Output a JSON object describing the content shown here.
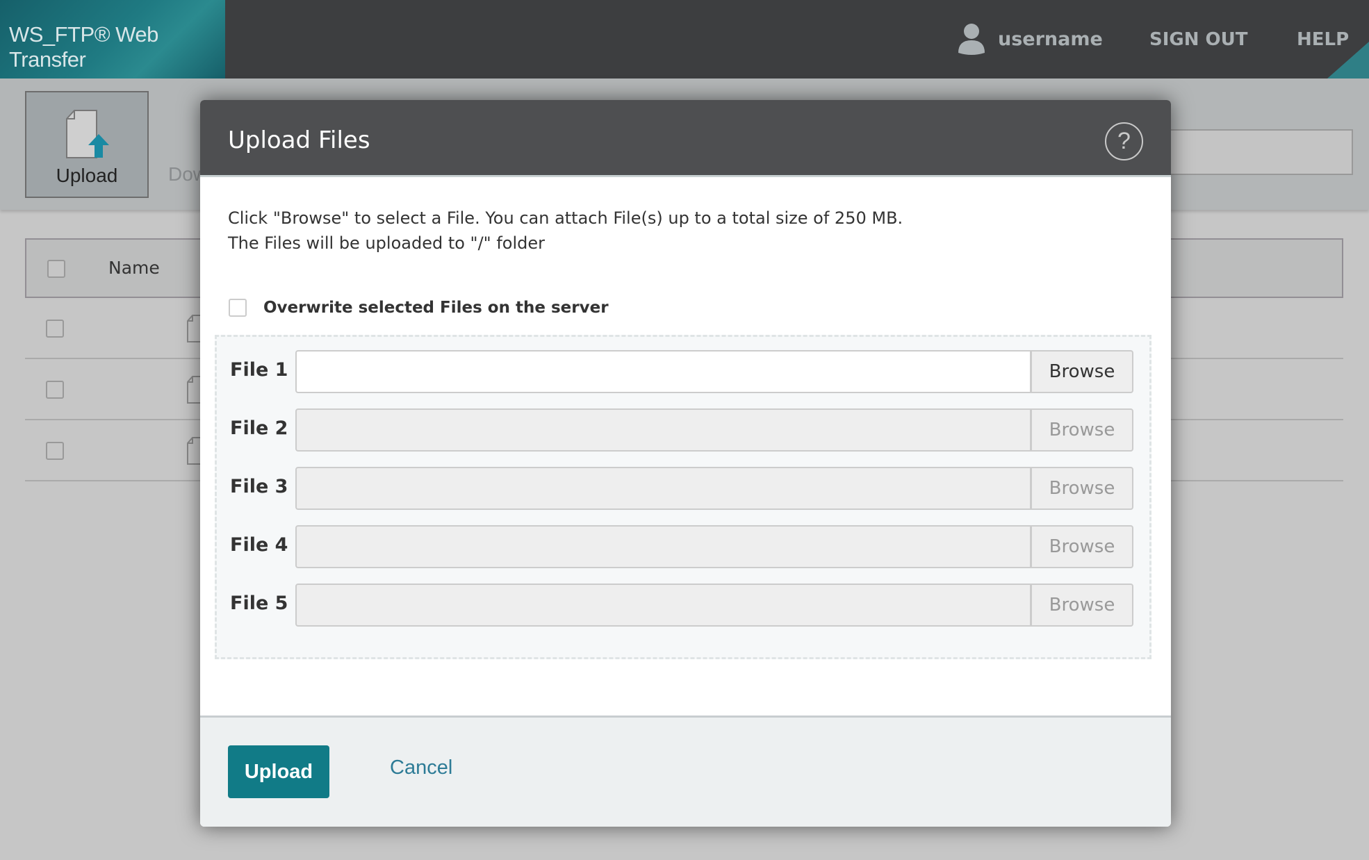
{
  "app": {
    "title": "WS_FTP® Web Transfer"
  },
  "header": {
    "username": "username",
    "sign_out": "SIGN OUT",
    "help": "HELP"
  },
  "toolbar": {
    "upload_label": "Upload",
    "download_label": "Dow"
  },
  "table": {
    "columns": [
      "Name"
    ],
    "rows": [
      {},
      {},
      {}
    ]
  },
  "dialog": {
    "title": "Upload Files",
    "instructions": [
      "Click \"Browse\" to select a File. You can attach File(s) up to a total size of 250 MB.",
      "The Files will be uploaded to \"/\" folder"
    ],
    "overwrite_label": "Overwrite selected Files on the server",
    "overwrite_checked": false,
    "files": [
      {
        "label": "File 1",
        "value": "",
        "browse": "Browse",
        "enabled": true
      },
      {
        "label": "File 2",
        "value": "",
        "browse": "Browse",
        "enabled": false
      },
      {
        "label": "File 3",
        "value": "",
        "browse": "Browse",
        "enabled": false
      },
      {
        "label": "File 4",
        "value": "",
        "browse": "Browse",
        "enabled": false
      },
      {
        "label": "File 5",
        "value": "",
        "browse": "Browse",
        "enabled": false
      }
    ],
    "upload_button": "Upload",
    "cancel_button": "Cancel"
  },
  "colors": {
    "accent": "#117b87",
    "header_bg": "#3d3e40",
    "link": "#2d7b96"
  }
}
